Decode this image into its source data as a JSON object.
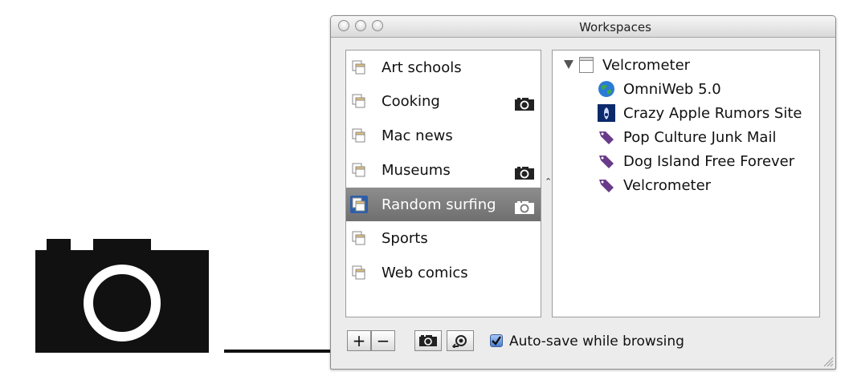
{
  "window": {
    "title": "Workspaces"
  },
  "workspaces": [
    {
      "label": "Art schools",
      "has_snapshot": false,
      "selected": false
    },
    {
      "label": "Cooking",
      "has_snapshot": true,
      "selected": false
    },
    {
      "label": "Mac news",
      "has_snapshot": false,
      "selected": false
    },
    {
      "label": "Museums",
      "has_snapshot": true,
      "selected": false
    },
    {
      "label": "Random surfing",
      "has_snapshot": true,
      "selected": true
    },
    {
      "label": "Sports",
      "has_snapshot": false,
      "selected": false
    },
    {
      "label": "Web comics",
      "has_snapshot": false,
      "selected": false
    }
  ],
  "tree": {
    "root": {
      "label": "Velcrometer",
      "expanded": true
    },
    "children": [
      {
        "label": "OmniWeb 5.0",
        "icon": "globe-icon"
      },
      {
        "label": "Crazy Apple Rumors Site",
        "icon": "site-favicon-icon"
      },
      {
        "label": "Pop Culture Junk Mail",
        "icon": "bookmark-tag-icon"
      },
      {
        "label": "Dog Island Free Forever",
        "icon": "bookmark-tag-icon"
      },
      {
        "label": "Velcrometer",
        "icon": "bookmark-tag-icon"
      }
    ]
  },
  "toolbar": {
    "add_label": "+",
    "remove_label": "−",
    "autosave_label": "Auto-save while browsing",
    "autosave_checked": true
  },
  "colors": {
    "selection": "#7a7a7a",
    "tag": "#6a3a8a",
    "checkbox": "#4a7fd3"
  }
}
